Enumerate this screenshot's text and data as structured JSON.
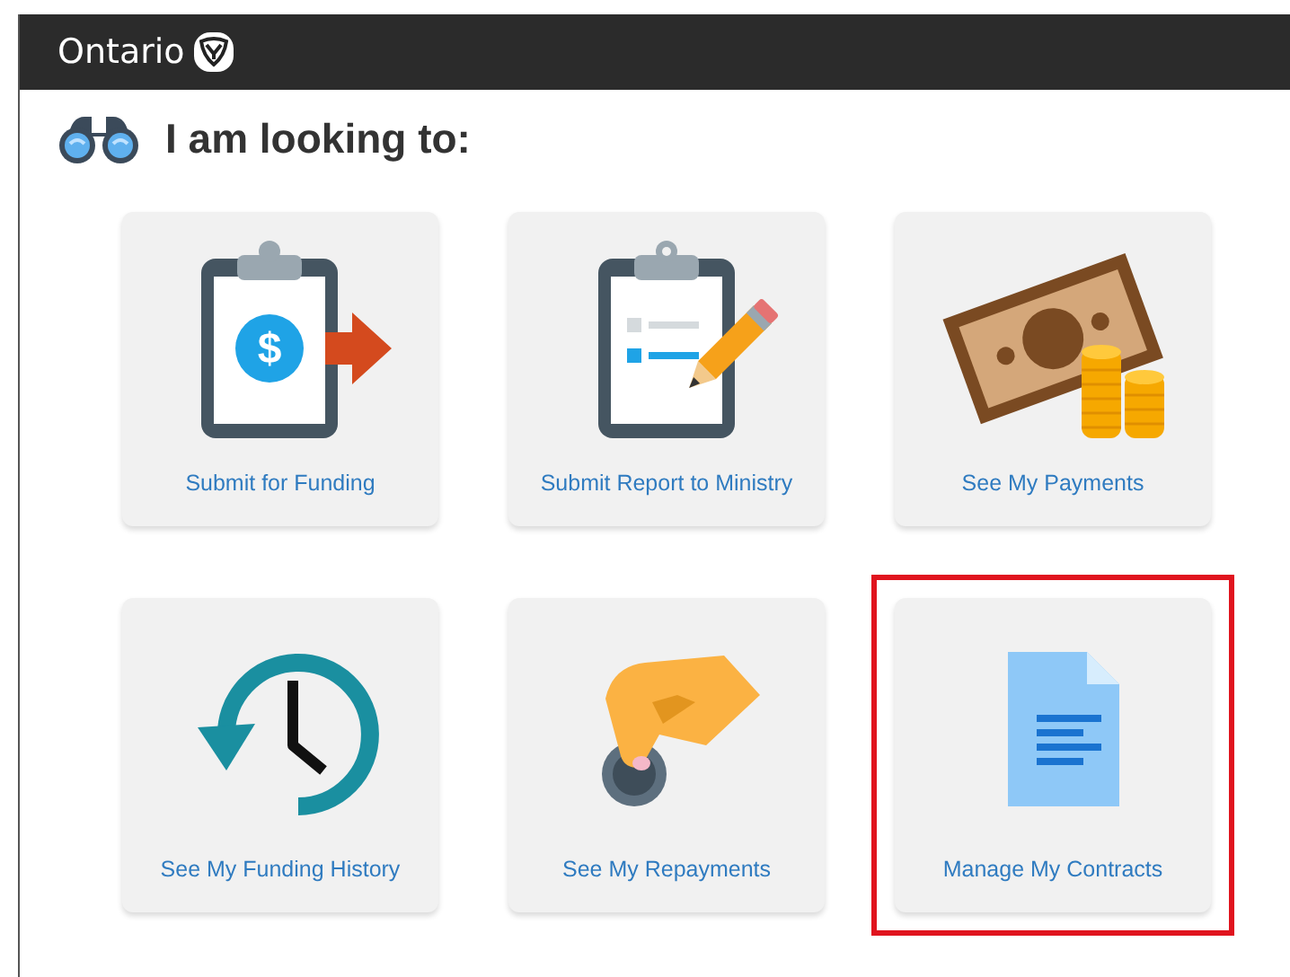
{
  "header": {
    "brand": "Ontario"
  },
  "heading": "I am looking to:",
  "tiles": [
    {
      "kind": "funding",
      "icon_text": "$",
      "label": "Submit for Funding",
      "highlighted": false
    },
    {
      "kind": "report",
      "label": "Submit Report to Ministry",
      "highlighted": false
    },
    {
      "kind": "payments",
      "label": "See My Payments",
      "highlighted": false
    },
    {
      "kind": "history",
      "label": "See My Funding History",
      "highlighted": false
    },
    {
      "kind": "repayments",
      "label": "See My Repayments",
      "highlighted": false
    },
    {
      "kind": "contracts",
      "label": "Manage My Contracts",
      "highlighted": true
    }
  ]
}
